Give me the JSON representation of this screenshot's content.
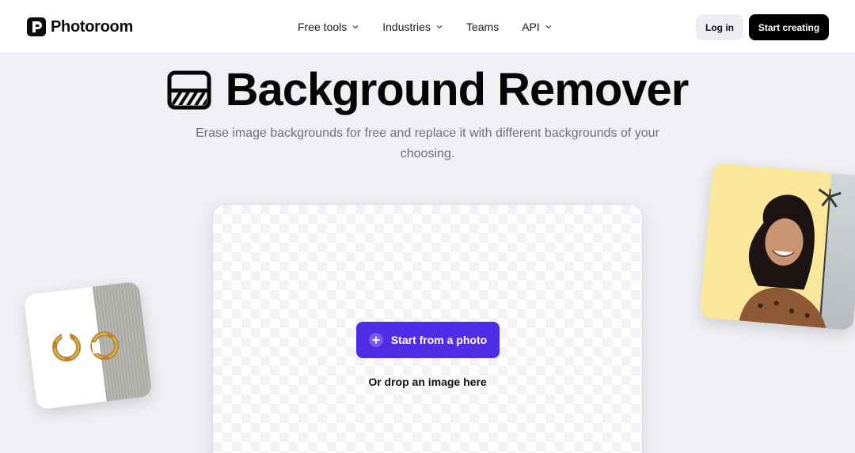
{
  "brand": {
    "name": "Photoroom"
  },
  "nav": {
    "items": [
      {
        "label": "Free tools",
        "has_dropdown": true
      },
      {
        "label": "Industries",
        "has_dropdown": true
      },
      {
        "label": "Teams",
        "has_dropdown": false
      },
      {
        "label": "API",
        "has_dropdown": true
      }
    ]
  },
  "header": {
    "login_label": "Log in",
    "start_label": "Start creating"
  },
  "hero": {
    "title": "Background Remover",
    "subtitle": "Erase image backgrounds for free and replace it with different backgrounds of your choosing."
  },
  "upload": {
    "button_label": "Start from a photo",
    "drop_text": "Or drop an image here"
  },
  "colors": {
    "accent": "#4f2de6",
    "page_bg": "#eff0f4",
    "header_bg": "#ffffff",
    "primary_button": "#000000"
  },
  "icons": {
    "logo": "photoroom-logo-icon",
    "hero": "background-remover-icon",
    "upload": "plus-circle-icon",
    "dropdown": "chevron-down-icon"
  }
}
